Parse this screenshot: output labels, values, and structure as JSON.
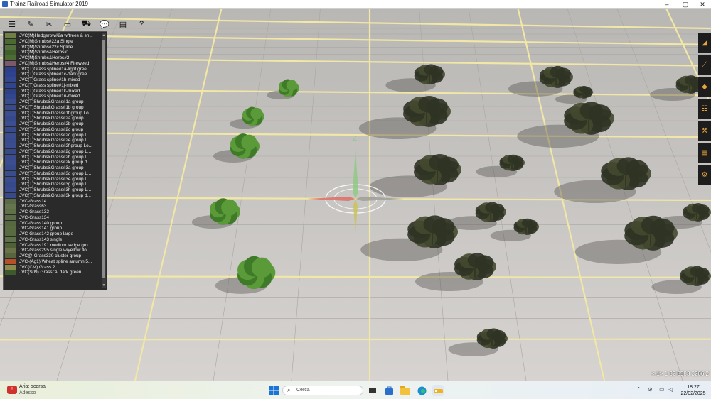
{
  "window": {
    "title": "Trainz Railroad Simulator 2019",
    "minimize_icon": "minimize-icon",
    "maximize_icon": "maximize-icon",
    "close_icon": "close-icon"
  },
  "toolbar": {
    "icons": [
      "menu-icon",
      "paint-brush-icon",
      "tools-icon",
      "monitor-icon",
      "train-icon",
      "chat-icon",
      "window-icon",
      "help-icon"
    ],
    "glyphs": [
      "☰",
      "✎",
      "✂",
      "▭",
      "⛟",
      "💬",
      "▤",
      "?"
    ]
  },
  "asset_list": {
    "items": [
      "JVC(M)Hedgerow#2a w/trees & sh...",
      "JVC(M)Shrubs#22a Single",
      "JVC(M)Shrubs#22c Spline",
      "JVC(M)Shrubs&Herbs#1",
      "JVC(M)Shrubs&Herbs#2",
      "JVC(M)Shrubs&Herbs#4 Fireweed",
      "JVC(T)Grass spline#1a-light gree...",
      "JVC(T)Grass spline#1c-dark gree...",
      "JVC(T)Grass spline#1h-mixed",
      "JVC(T)Grass spline#1j-mixed",
      "JVC(T)Grass spline#1k-mixed",
      "JVC(T)Grass spline#1n-mixed",
      "JVC(T)Shrubs&Grass#1a group",
      "JVC(T)Shrubs&Grass#1b group",
      "JVC(T)Shrubs&Grass#1f group Lo...",
      "JVC(T)Shrubs&Grass#2a group",
      "JVC(T)Shrubs&Grass#2b group",
      "JVC(T)Shrubs&Grass#2c group",
      "JVC(T)Shrubs&Grass#2d group L...",
      "JVC(T)Shrubs&Grass#2e group L...",
      "JVC(T)Shrubs&Grass#2f group Lo...",
      "JVC(T)Shrubs&Grass#2g group L...",
      "JVC(T)Shrubs&Grass#2h group L...",
      "JVC(T)Shrubs&Grass#2k group d...",
      "JVC(T)Shrubs&Grass#3a group",
      "JVC(T)Shrubs&Grass#3d group L...",
      "JVC(T)Shrubs&Grass#3e group L...",
      "JVC(T)Shrubs&Grass#3g group L...",
      "JVC(T)Shrubs&Grass#3h group L...",
      "JVC(T)Shrubs&Grass#3k group d...",
      "JVC-Grass14",
      "JVC-Grass63",
      "JVC-Grass132",
      "JVC-Grass134",
      "JVC-Grass140 group",
      "JVC-Grass141 group",
      "JVC-Grass142 group large",
      "JVC-Grass143 single",
      "JVC-Grass191 medium sedge gro...",
      "JVC-Grass295 single w/yellow flo...",
      "JVC@-Grass330 cluster group",
      "JVC-(Ag1) Wheat spline autumn 5...",
      "JVC(CM) Grass 2",
      "JVC(S09) Grass 'A' dark green"
    ],
    "thumb_colors": [
      "#6f7f46",
      "#4a6a30",
      "#55703a",
      "#3f5f2c",
      "#4e6b33",
      "#7a5a6a",
      "#2b3f8a",
      "#2e428e",
      "#34478f",
      "#304590",
      "#2d4189",
      "#32468e",
      "#3a4c8c",
      "#384a8a",
      "#3b4d8f",
      "#36498b",
      "#3c4e90",
      "#374a8c",
      "#3a4d8e",
      "#394b8d",
      "#3b4d8f",
      "#364989",
      "#3a4c8e",
      "#3c4e90",
      "#374a8b",
      "#394c8e",
      "#3b4d8f",
      "#36498b",
      "#3a4c8e",
      "#384a8c",
      "#5b6a48",
      "#66754e",
      "#607049",
      "#5d6c47",
      "#56683e",
      "#5a6b43",
      "#586a40",
      "#607048",
      "#4f6236",
      "#6c7248",
      "#556640",
      "#b5502a",
      "#8a8a4a",
      "#3e5a2c"
    ]
  },
  "right_tools": {
    "icons": [
      "terrain-paint-icon",
      "track-icon",
      "object-icon",
      "ladder-icon",
      "wrench-icon",
      "layers-icon",
      "gear-icon"
    ],
    "glyphs": [
      "◢",
      "⟋",
      "◆",
      "☷",
      "⚒",
      "▤",
      "⚙"
    ]
  },
  "status": {
    "coordinates": "<-1> 1 32 8583 3266 2"
  },
  "taskbar": {
    "weather_title": "Aria: scarsa",
    "weather_subtitle": "Adesso",
    "search_placeholder": "Cerca",
    "time": "18:27",
    "date": "22/02/2025",
    "start_icon": "windows-start-icon",
    "app_icons": [
      "task-view-icon",
      "store-icon",
      "file-explorer-icon",
      "edge-browser-icon",
      "trainz-app-icon"
    ],
    "tray_icons": [
      "chevron-up-icon",
      "network-off-icon",
      "display-icon",
      "volume-icon"
    ]
  },
  "colors": {
    "grid_line": "#f0e6a2",
    "ground": "#c9c6c3",
    "panel_bg": "#2a2a2a",
    "taskbar_bg": "#eef3f0"
  }
}
